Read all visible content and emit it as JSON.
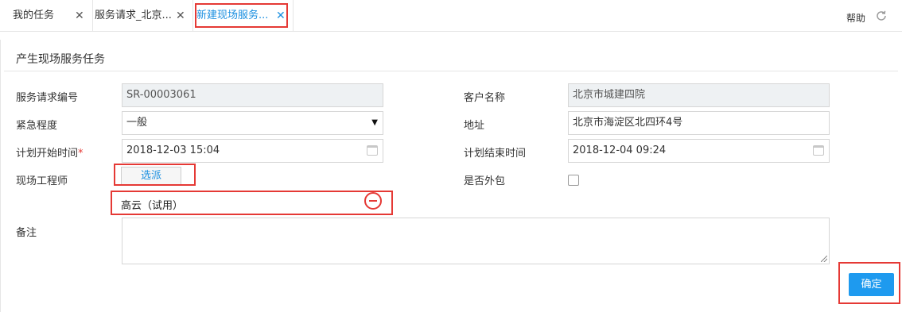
{
  "tabs": [
    {
      "label": "我的任务",
      "active": false
    },
    {
      "label": "服务请求_北京...",
      "active": false
    },
    {
      "label": "新建现场服务...",
      "active": true
    }
  ],
  "tab_close_glyph": "✕",
  "header": {
    "help_label": "帮助",
    "refresh_icon": "refresh-icon"
  },
  "section": {
    "title": "产生现场服务任务"
  },
  "form": {
    "request_no": {
      "label": "服务请求编号",
      "value": "SR-00003061"
    },
    "urgency": {
      "label": "紧急程度",
      "value": "一般"
    },
    "plan_start": {
      "label": "计划开始时间",
      "required_mark": "*",
      "value": "2018-12-03 15:04"
    },
    "engineer": {
      "label": "现场工程师",
      "assign_label": "选派",
      "selected": "高云（试用）"
    },
    "notes": {
      "label": "备注",
      "value": ""
    },
    "customer": {
      "label": "客户名称",
      "value": "北京市城建四院"
    },
    "address": {
      "label": "地址",
      "value": "北京市海淀区北四环4号"
    },
    "plan_end": {
      "label": "计划结束时间",
      "value": "2018-12-04 09:24"
    },
    "outsourced": {
      "label": "是否外包",
      "checked": false
    }
  },
  "actions": {
    "confirm_label": "确定"
  },
  "colors": {
    "accent": "#1a8fe0",
    "highlight": "#e53935",
    "button": "#1e9aef"
  }
}
